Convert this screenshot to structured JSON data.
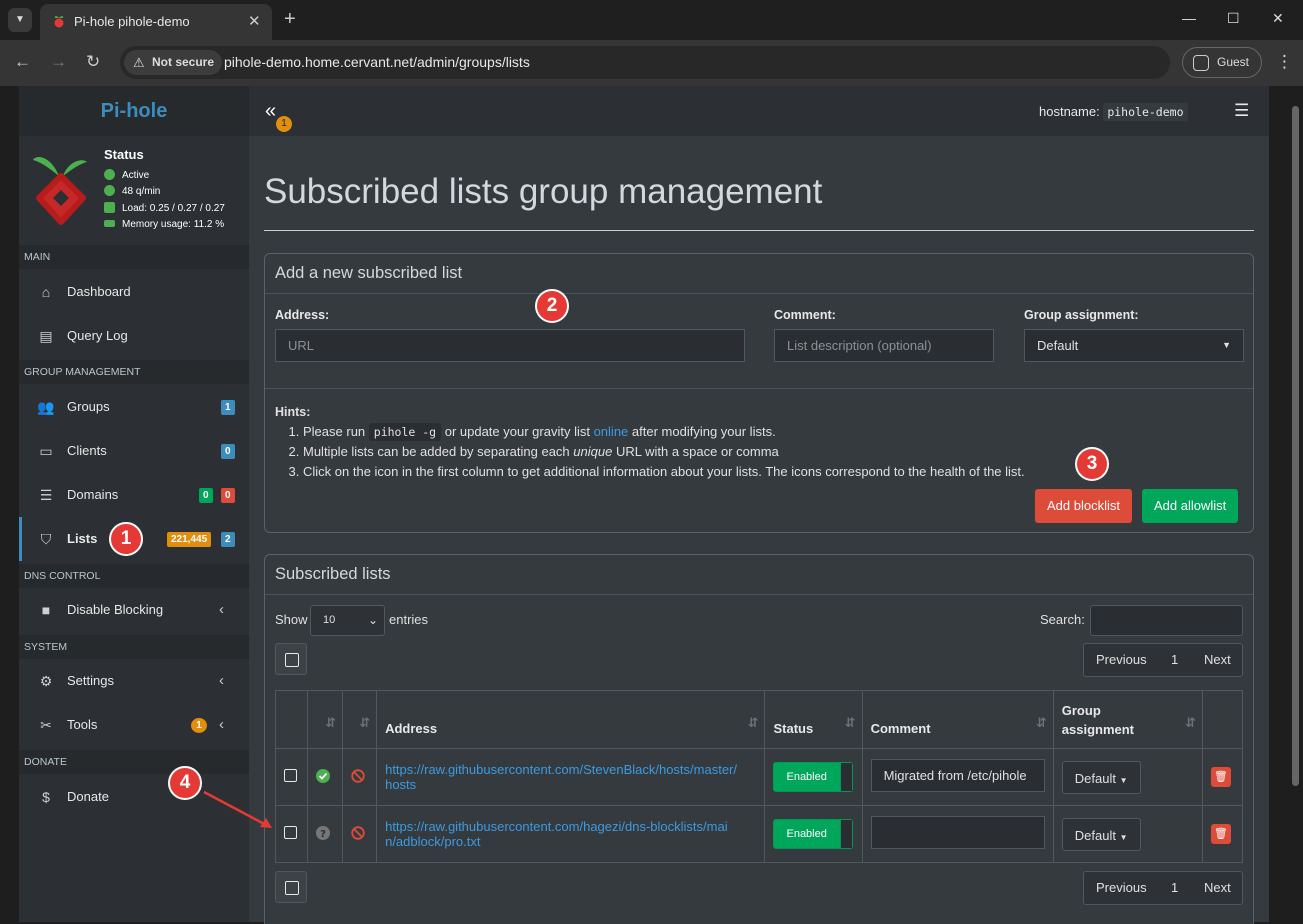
{
  "browser": {
    "tab_title": "Pi-hole pihole-demo",
    "not_secure": "Not secure",
    "url": "pihole-demo.home.cervant.net/admin/groups/lists",
    "guest": "Guest"
  },
  "sidebar": {
    "logo": "Pi-hole",
    "status": {
      "title": "Status",
      "active": "Active",
      "qps": "48 q/min",
      "load": "Load: 0.25 / 0.27 / 0.27",
      "memory": "Memory usage: 11.2 %"
    },
    "sections": {
      "main": "MAIN",
      "group_management": "GROUP MANAGEMENT",
      "dns_control": "DNS CONTROL",
      "system": "SYSTEM",
      "donate": "DONATE"
    },
    "items": {
      "dashboard": "Dashboard",
      "query_log": "Query Log",
      "groups": "Groups",
      "groups_badge": "1",
      "clients": "Clients",
      "clients_badge": "0",
      "domains": "Domains",
      "domains_badge_allow": "0",
      "domains_badge_deny": "0",
      "lists": "Lists",
      "lists_badge_domains": "221,445",
      "lists_badge_count": "2",
      "disable_blocking": "Disable Blocking",
      "settings": "Settings",
      "tools": "Tools",
      "tools_badge": "1",
      "donate": "Donate"
    }
  },
  "header": {
    "collapse_badge": "1",
    "hostname_label": "hostname:",
    "hostname_value": "pihole-demo"
  },
  "main": {
    "page_title": "Subscribed lists group management",
    "add_box": {
      "title": "Add a new subscribed list",
      "address_label": "Address:",
      "address_placeholder": "URL",
      "comment_label": "Comment:",
      "comment_placeholder": "List description (optional)",
      "group_label": "Group assignment:",
      "group_value": "Default",
      "hints_label": "Hints:",
      "hint1_pre": "Please run",
      "hint1_code": "pihole -g",
      "hint1_mid": "or update your gravity list",
      "hint1_link": "online",
      "hint1_post": "after modifying your lists.",
      "hint2_pre": "Multiple lists can be added by separating each",
      "hint2_em": "unique",
      "hint2_post": "URL with a space or comma",
      "hint3": "Click on the icon in the first column to get additional information about your lists. The icons correspond to the health of the list.",
      "add_blocklist": "Add blocklist",
      "add_allowlist": "Add allowlist"
    },
    "lists_box": {
      "title": "Subscribed lists",
      "show": "Show",
      "entries_value": "10",
      "entries": "entries",
      "search": "Search:",
      "previous": "Previous",
      "page": "1",
      "next": "Next",
      "columns": {
        "address": "Address",
        "status": "Status",
        "comment": "Comment",
        "group": "Group assignment"
      },
      "rows": [
        {
          "address_line1": "https://raw.githubusercontent.com/StevenBlack/hosts/master/",
          "address_line2": "hosts",
          "status": "Enabled",
          "comment": "Migrated from /etc/pihole",
          "group": "Default"
        },
        {
          "address_line1": "https://raw.githubusercontent.com/hagezi/dns-blocklists/mai",
          "address_line2": "n/adblock/pro.txt",
          "status": "Enabled",
          "comment": "",
          "group": "Default"
        }
      ]
    }
  },
  "annotations": [
    "1",
    "2",
    "3",
    "4"
  ],
  "colors": {
    "accent": "#3c8dbc",
    "danger": "#dd4b39",
    "success": "#00a65a",
    "warning": "#e08e0b"
  }
}
